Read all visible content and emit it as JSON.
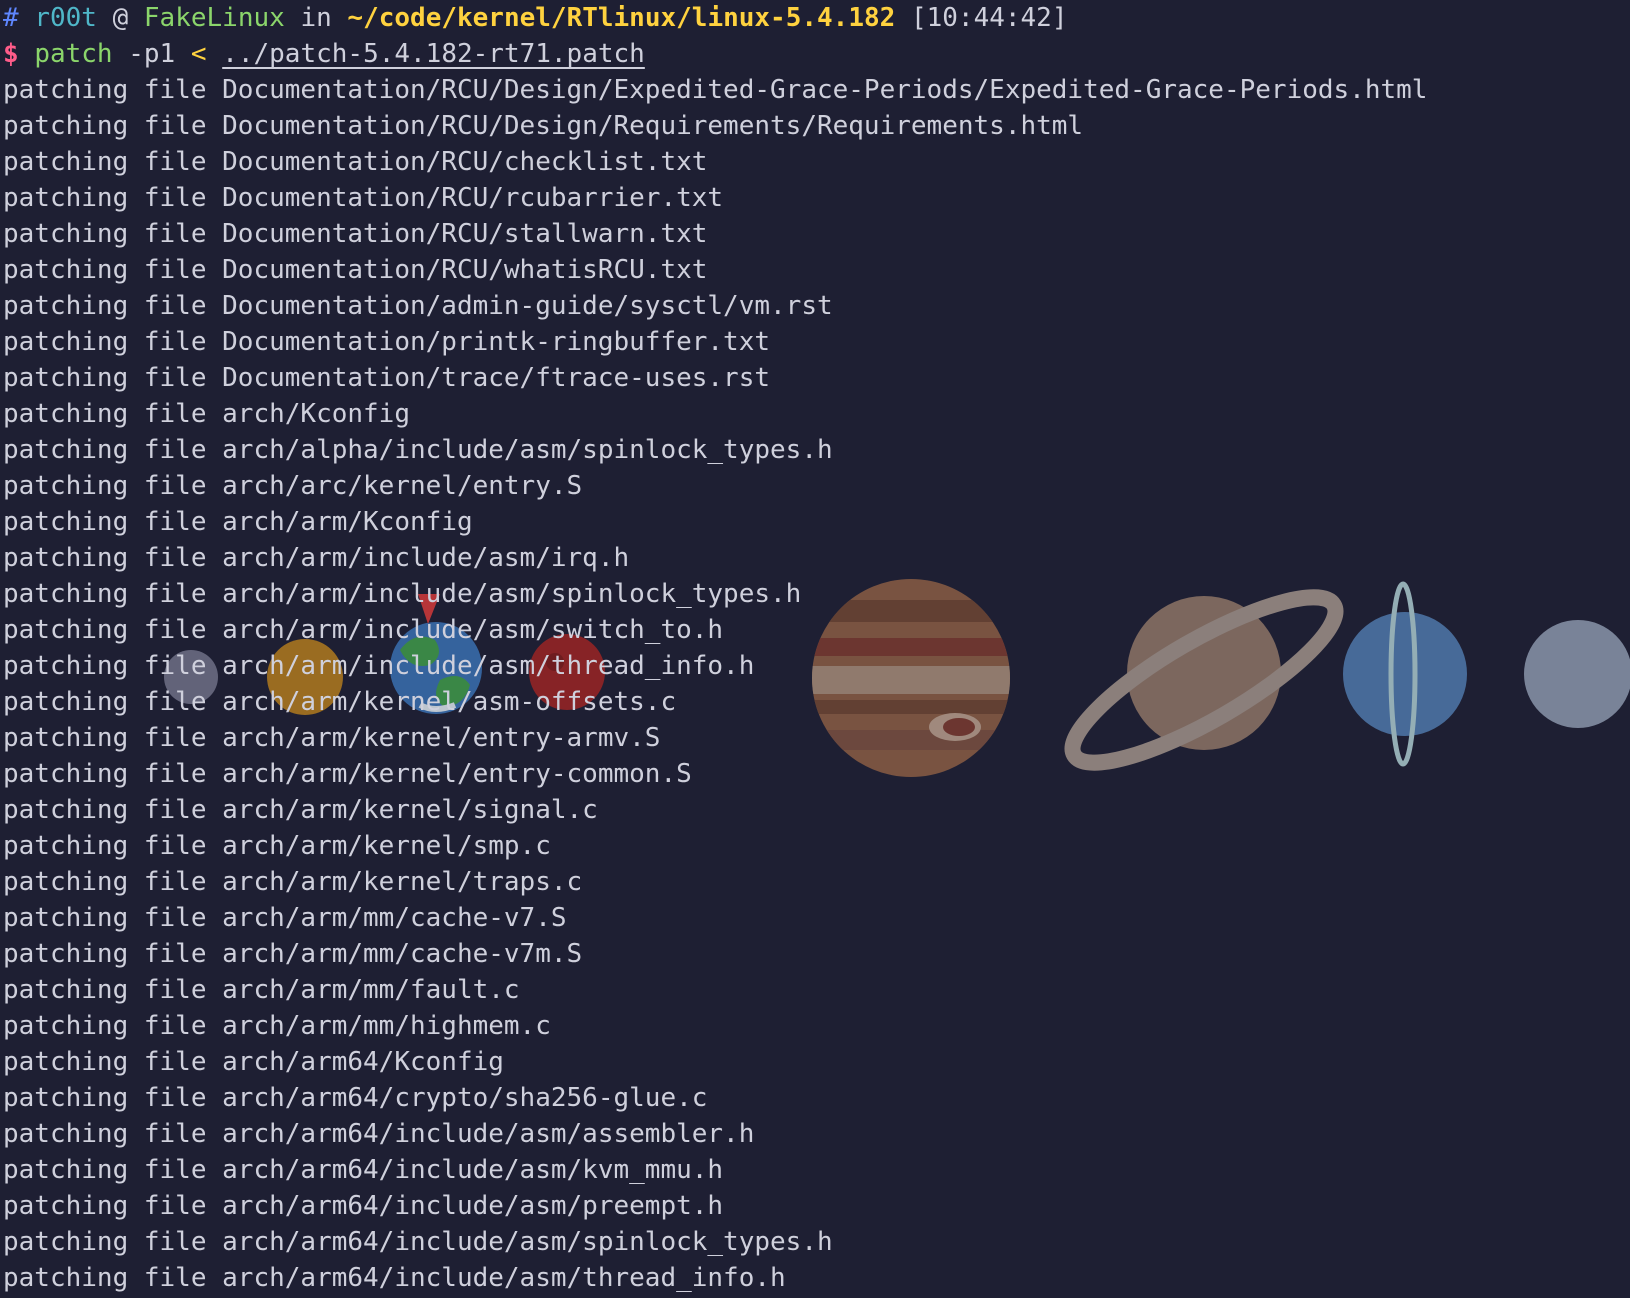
{
  "prompt": {
    "hash": "#",
    "user": "r00t",
    "at": "@",
    "host": "FakeLinux",
    "in": "in",
    "cwd": "~/code/kernel/RTlinux/linux-5.4.182",
    "time": "[10:44:42]"
  },
  "command": {
    "symbol": "$",
    "name": "patch",
    "arg": "-p1",
    "redirect": "<",
    "file": "../patch-5.4.182-rt71.patch"
  },
  "output": [
    "patching file Documentation/RCU/Design/Expedited-Grace-Periods/Expedited-Grace-Periods.html",
    "patching file Documentation/RCU/Design/Requirements/Requirements.html",
    "patching file Documentation/RCU/checklist.txt",
    "patching file Documentation/RCU/rcubarrier.txt",
    "patching file Documentation/RCU/stallwarn.txt",
    "patching file Documentation/RCU/whatisRCU.txt",
    "patching file Documentation/admin-guide/sysctl/vm.rst",
    "patching file Documentation/printk-ringbuffer.txt",
    "patching file Documentation/trace/ftrace-uses.rst",
    "patching file arch/Kconfig",
    "patching file arch/alpha/include/asm/spinlock_types.h",
    "patching file arch/arc/kernel/entry.S",
    "patching file arch/arm/Kconfig",
    "patching file arch/arm/include/asm/irq.h",
    "patching file arch/arm/include/asm/spinlock_types.h",
    "patching file arch/arm/include/asm/switch_to.h",
    "patching file arch/arm/include/asm/thread_info.h",
    "patching file arch/arm/kernel/asm-offsets.c",
    "patching file arch/arm/kernel/entry-armv.S",
    "patching file arch/arm/kernel/entry-common.S",
    "patching file arch/arm/kernel/signal.c",
    "patching file arch/arm/kernel/smp.c",
    "patching file arch/arm/kernel/traps.c",
    "patching file arch/arm/mm/cache-v7.S",
    "patching file arch/arm/mm/cache-v7m.S",
    "patching file arch/arm/mm/fault.c",
    "patching file arch/arm/mm/highmem.c",
    "patching file arch/arm64/Kconfig",
    "patching file arch/arm64/crypto/sha256-glue.c",
    "patching file arch/arm64/include/asm/assembler.h",
    "patching file arch/arm64/include/asm/kvm_mmu.h",
    "patching file arch/arm64/include/asm/preempt.h",
    "patching file arch/arm64/include/asm/spinlock_types.h",
    "patching file arch/arm64/include/asm/thread_info.h"
  ],
  "colors": {
    "background": "#1e1f33",
    "text": "#cfd0dc",
    "prompt_hash": "#5f87ff",
    "prompt_user": "#4fb6c8",
    "prompt_host": "#8bd56b",
    "prompt_path": "#ffd23f",
    "dollar": "#ff5c8a"
  },
  "decorations": [
    "mercury-icon",
    "venus-icon",
    "earth-icon",
    "mars-icon",
    "jupiter-icon",
    "saturn-icon",
    "uranus-icon",
    "neptune-icon"
  ]
}
